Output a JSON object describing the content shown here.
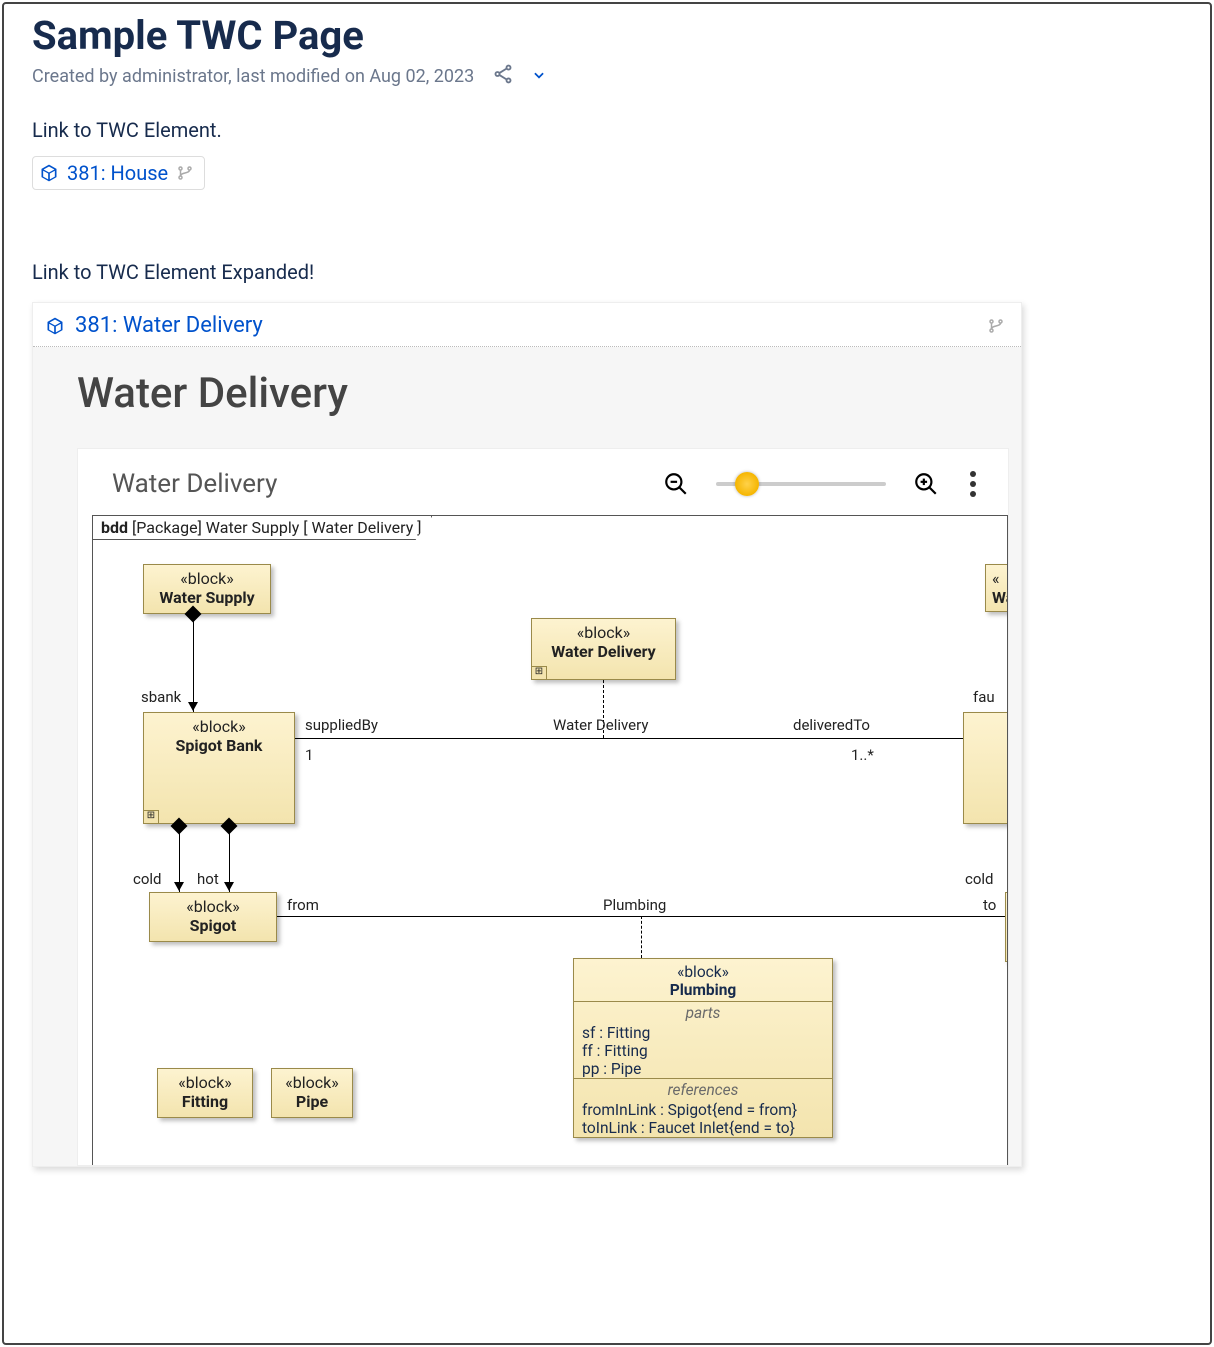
{
  "page": {
    "title": "Sample TWC Page",
    "meta": "Created by administrator, last modified on Aug 02, 2023"
  },
  "section1": {
    "text": "Link to TWC Element.",
    "link_label": "381: House"
  },
  "section2": {
    "text": "Link to TWC Element Expanded!",
    "header_link": "381: Water Delivery",
    "body_title": "Water Delivery"
  },
  "diagram": {
    "toolbar_title": "Water Delivery",
    "frame_prefix": "bdd",
    "frame_context": "[Package] Water Supply [ Water Delivery ]",
    "blocks": {
      "water_supply": {
        "stereo": "«block»",
        "name": "Water Supply"
      },
      "water_delivery": {
        "stereo": "«block»",
        "name": "Water Delivery"
      },
      "wat_cut": {
        "stereo": "«",
        "name": "Wat"
      },
      "spigot_bank": {
        "stereo": "«block»",
        "name": "Spigot Bank"
      },
      "spigot": {
        "stereo": "«block»",
        "name": "Spigot"
      },
      "fitting": {
        "stereo": "«block»",
        "name": "Fitting"
      },
      "pipe": {
        "stereo": "«block»",
        "name": "Pipe"
      },
      "plumbing": {
        "stereo": "«block»",
        "name": "Plumbing",
        "parts_label": "parts",
        "parts": [
          "sf : Fitting",
          "ff : Fitting",
          "pp : Pipe"
        ],
        "refs_label": "references",
        "refs": [
          "fromInLink : Spigot{end = from}",
          "toInLink : Faucet Inlet{end = to}"
        ]
      }
    },
    "labels": {
      "sbank": "sbank",
      "suppliedBy": "suppliedBy",
      "assoc_center": "Water Delivery",
      "deliveredTo": "deliveredTo",
      "one": "1",
      "one_star": "1..*",
      "fau": "fau",
      "cold_l": "cold",
      "hot": "hot",
      "cold_r": "cold",
      "from": "from",
      "plumbing_assoc": "Plumbing",
      "to": "to"
    }
  }
}
